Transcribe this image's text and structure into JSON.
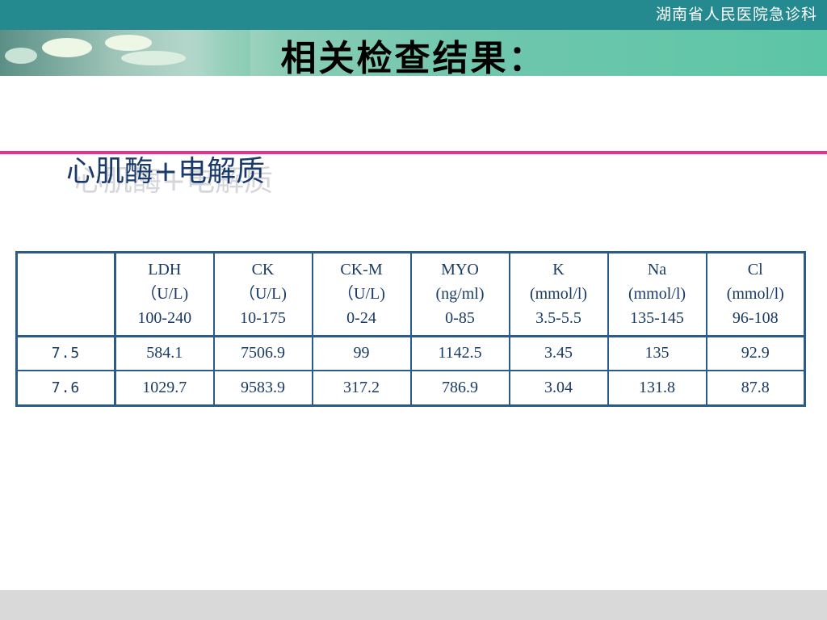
{
  "header": {
    "hospital_name": "湖南省人民医院急诊科",
    "title": "相关检查结果："
  },
  "section": {
    "subtitle": "心肌酶+电解质"
  },
  "table": {
    "columns": [
      {
        "name": "LDH",
        "unit": "（U/L)",
        "range": "100-240"
      },
      {
        "name": "CK",
        "unit": "（U/L)",
        "range": "10-175"
      },
      {
        "name": "CK-M",
        "unit": "（U/L)",
        "range": "0-24"
      },
      {
        "name": "MYO",
        "unit": "(ng/ml)",
        "range": "0-85"
      },
      {
        "name": "K",
        "unit": "(mmol/l)",
        "range": "3.5-5.5"
      },
      {
        "name": "Na",
        "unit": "(mmol/l)",
        "range": "135-145"
      },
      {
        "name": "Cl",
        "unit": "(mmol/l)",
        "range": "96-108"
      }
    ],
    "rows": [
      {
        "date": "7.5",
        "values": [
          "584.1",
          "7506.9",
          "99",
          "1142.5",
          "3.45",
          "135",
          "92.9"
        ]
      },
      {
        "date": "7.6",
        "values": [
          "1029.7",
          "9583.9",
          "317.2",
          "786.9",
          "3.04",
          "131.8",
          "87.8"
        ]
      }
    ]
  },
  "colors": {
    "top_bar": "#258a8f",
    "accent_line": "#e6338f",
    "table_border": "#2b5a8c",
    "subtitle_text": "#1a3a6b"
  }
}
